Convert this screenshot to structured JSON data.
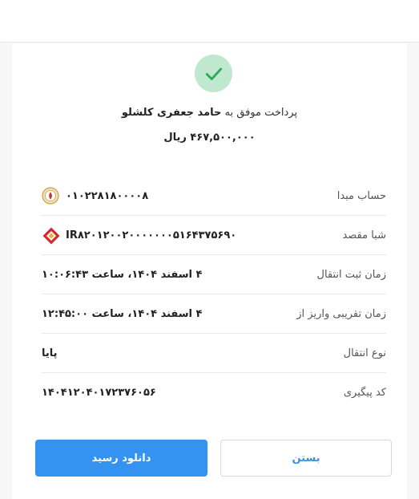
{
  "header": {
    "title": ""
  },
  "status": {
    "icon": "check-icon",
    "color": "#bfe8cf",
    "check_color": "#2eaa5c"
  },
  "payment": {
    "prefix": "پرداخت موفق به",
    "recipient": "حامد جعفری کلشلو",
    "amount": "۴۶۷,۵۰۰,۰۰۰ ریال"
  },
  "rows": [
    {
      "label": "حساب مبدا",
      "value": "۰۱۰۲۲۸۱۸۰۰۰۰۸",
      "icon": "bank-melli-logo-icon"
    },
    {
      "label": "شبا مقصد",
      "value": "IR۸۲۰۱۲۰۰۲۰۰۰۰۰۰۰۵۱۶۴۳۷۵۶۹۰",
      "icon": "bank-mellat-logo-icon"
    },
    {
      "label": "زمان ثبت انتقال",
      "value": "۴ اسفند ۱۴۰۴، ساعت ۱۰:۰۶:۴۳"
    },
    {
      "label": "زمان تقریبی واریز از",
      "value": "۴ اسفند ۱۴۰۴، ساعت ۱۲:۴۵:۰۰"
    },
    {
      "label": "نوع انتقال",
      "value": "پایا"
    },
    {
      "label": "کد پیگیری",
      "value": "۱۴۰۴۱۲۰۴۰۱۷۲۳۷۶۰۵۶"
    }
  ],
  "buttons": {
    "download_label": "دانلود رسید",
    "close_label": "بستن"
  },
  "colors": {
    "primary": "#3492f0",
    "link": "#3a8fe0"
  }
}
